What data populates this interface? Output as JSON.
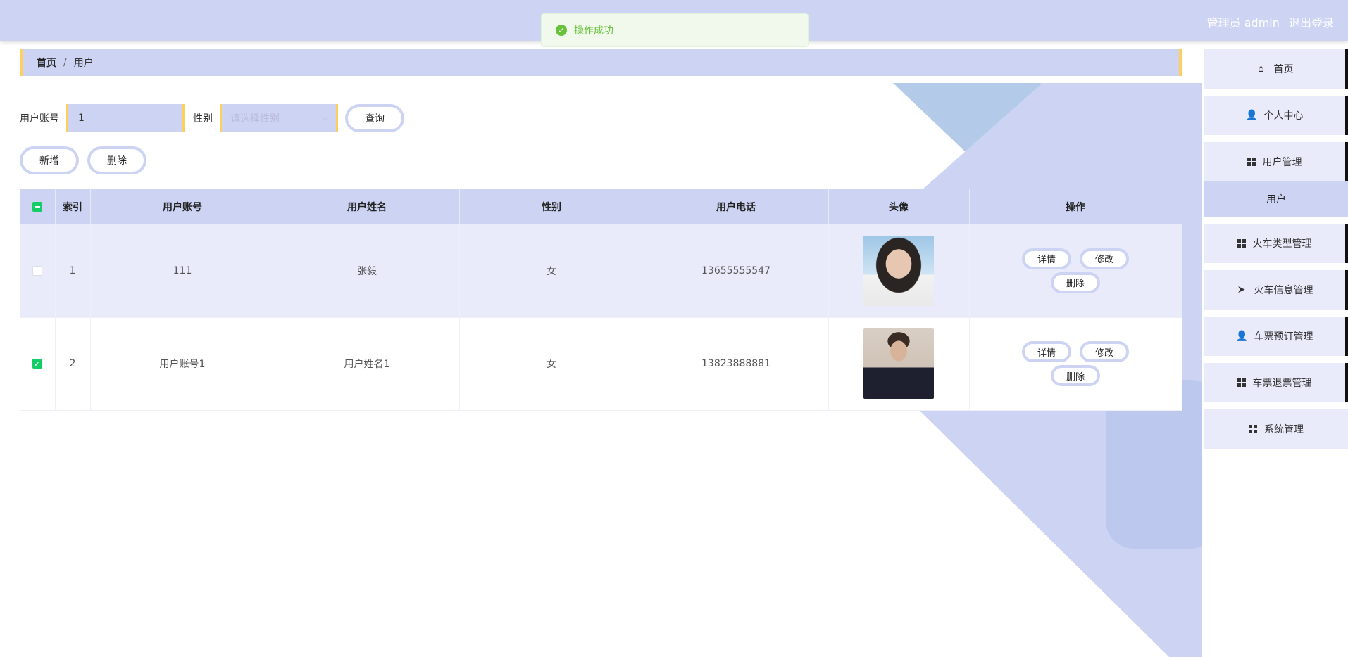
{
  "header": {
    "user_label": "管理员 admin",
    "logout_label": "退出登录"
  },
  "toast": {
    "message": "操作成功"
  },
  "breadcrumb": {
    "home": "首页",
    "separator": "/",
    "current": "用户"
  },
  "search": {
    "account_label": "用户账号",
    "account_value": "1",
    "sex_label": "性别",
    "sex_placeholder": "请选择性别",
    "query_label": "查询"
  },
  "actions": {
    "add_label": "新增",
    "delete_label": "删除"
  },
  "table": {
    "headers": [
      "索引",
      "用户账号",
      "用户姓名",
      "性别",
      "用户电话",
      "头像",
      "操作"
    ],
    "rows": [
      {
        "index": "1",
        "account": "111",
        "name": "张毅",
        "sex": "女",
        "phone": "13655555547",
        "checked": false
      },
      {
        "index": "2",
        "account": "用户账号1",
        "name": "用户姓名1",
        "sex": "女",
        "phone": "13823888881",
        "checked": true
      }
    ],
    "row_actions": {
      "detail": "详情",
      "edit": "修改",
      "delete": "删除"
    }
  },
  "sidebar": {
    "items": [
      {
        "label": "首页",
        "icon": "home-icon"
      },
      {
        "label": "个人中心",
        "icon": "user-icon"
      },
      {
        "label": "用户管理",
        "icon": "grid-icon"
      },
      {
        "label": "火车类型管理",
        "icon": "grid-icon"
      },
      {
        "label": "火车信息管理",
        "icon": "send-icon"
      },
      {
        "label": "车票预订管理",
        "icon": "user-icon"
      },
      {
        "label": "车票退票管理",
        "icon": "grid-icon"
      },
      {
        "label": "系统管理",
        "icon": "grid-icon"
      }
    ],
    "submenu_label": "用户"
  },
  "colors": {
    "primary": "#cdd3f3",
    "accent_border": "#ffcf5b",
    "success": "#67c23a",
    "checkbox": "#13ce66"
  }
}
